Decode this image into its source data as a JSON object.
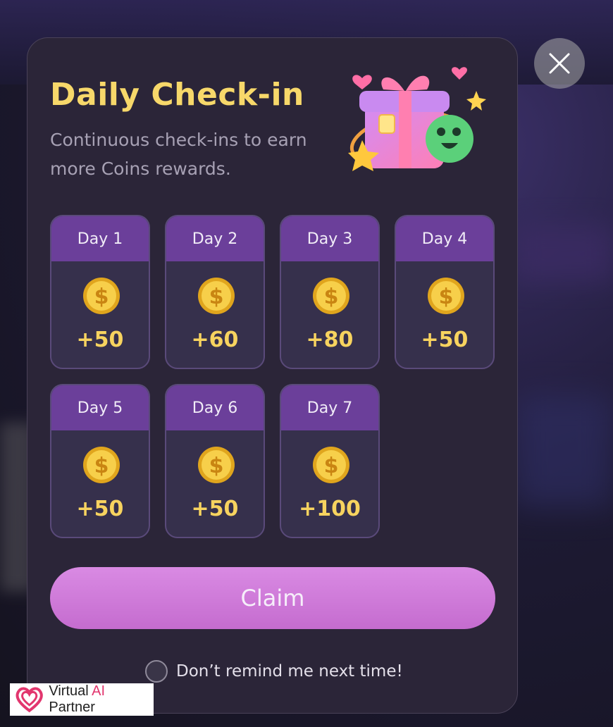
{
  "modal": {
    "title": "Daily Check-in",
    "subtitle": "Continuous check-ins to earn more Coins rewards."
  },
  "days": [
    {
      "label": "Day 1",
      "amount": "+50"
    },
    {
      "label": "Day 2",
      "amount": "+60"
    },
    {
      "label": "Day 3",
      "amount": "+80"
    },
    {
      "label": "Day 4",
      "amount": "+50"
    },
    {
      "label": "Day 5",
      "amount": "+50"
    },
    {
      "label": "Day 6",
      "amount": "+50"
    },
    {
      "label": "Day 7",
      "amount": "+100"
    }
  ],
  "claim_label": "Claim",
  "remind_label": "Don’t remind me next time!",
  "watermark": {
    "prefix": "Virtual ",
    "highlight": "AI",
    "suffix": " Partner"
  },
  "icons": {
    "close": "close-icon",
    "coin": "coin-icon",
    "gift": "gift-illustration",
    "heart_logo": "heart-logo-icon"
  },
  "colors": {
    "accent_title": "#f7d86a",
    "day_header": "#6b3f9a",
    "claim": "#d17de0",
    "amount": "#f7d35f",
    "brand": "#e2366e"
  }
}
